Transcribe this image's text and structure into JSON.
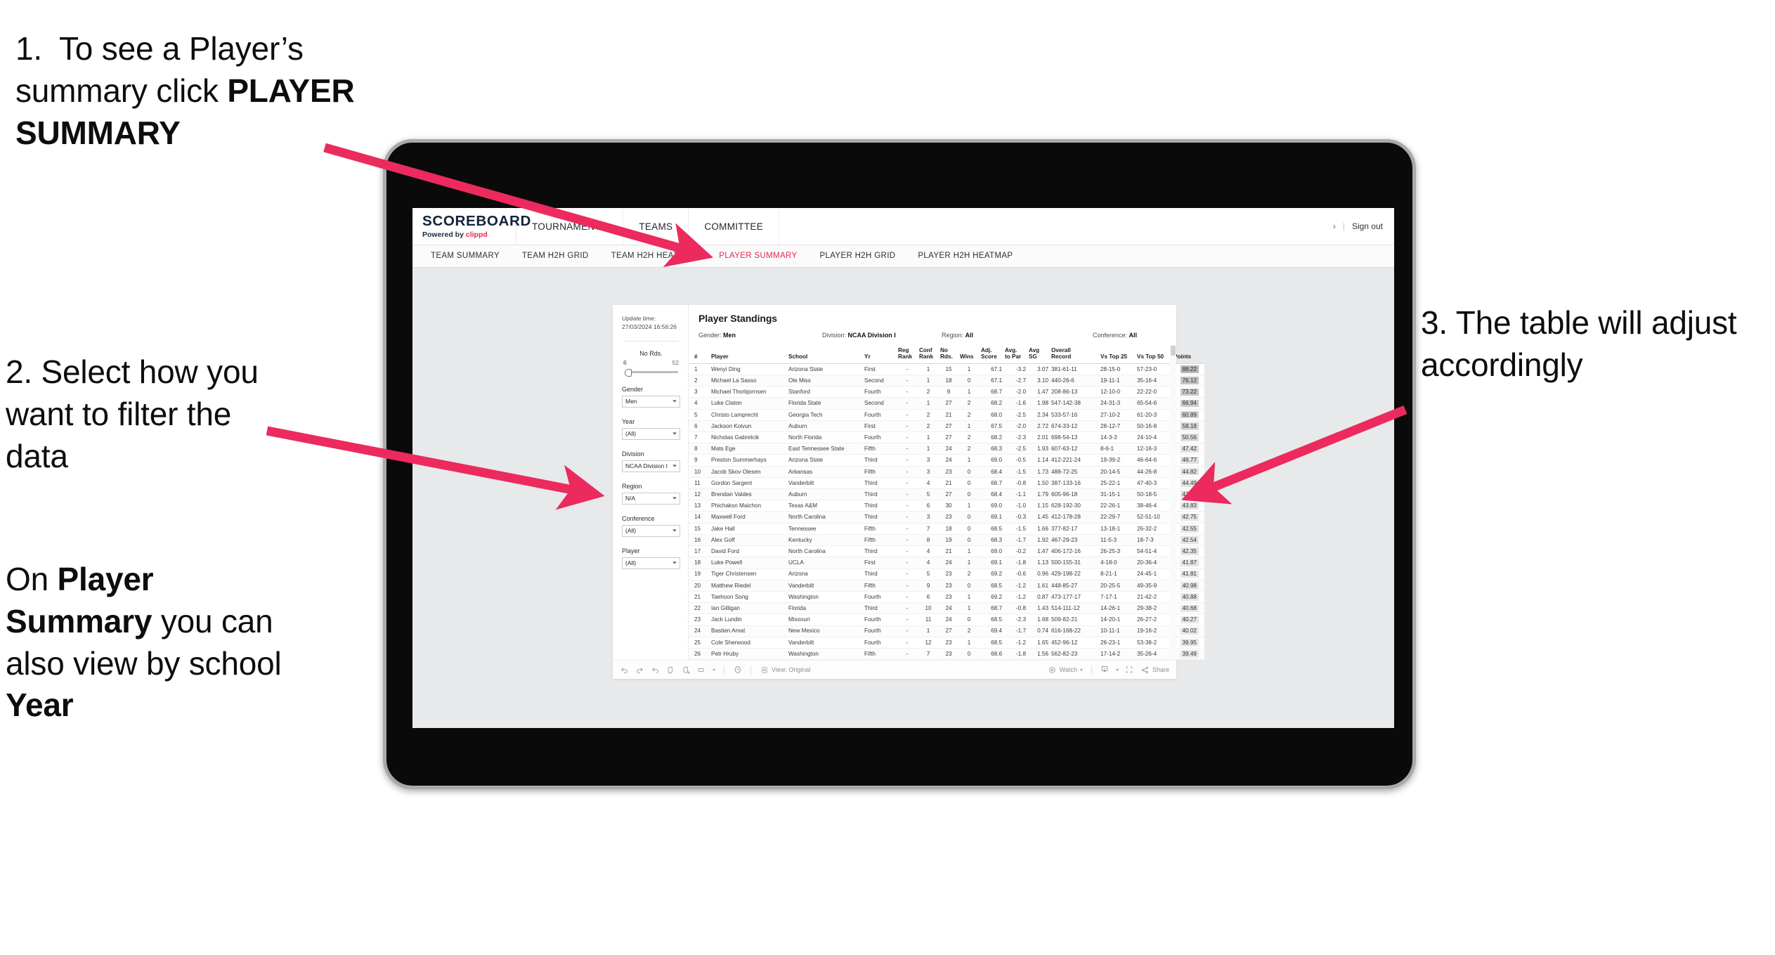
{
  "annotations": {
    "step1": {
      "number": "1.",
      "line1": "To see a Player’s",
      "line2_pre": "summary click ",
      "line2_bold": "PLAYER",
      "line3_bold": "SUMMARY"
    },
    "step2": {
      "text": "2. Select how you want to filter the data"
    },
    "step2b": {
      "pre": "On ",
      "bold1": "Player Summary",
      "mid": " you can also view by school ",
      "bold2": "Year"
    },
    "step3": {
      "text": "3. The table will adjust accordingly"
    }
  },
  "app": {
    "brand": {
      "title": "SCOREBOARD",
      "powered_prefix": "Powered by ",
      "powered_name": "clippd"
    },
    "main_nav": [
      {
        "label": "TOURNAMENTS"
      },
      {
        "label": "TEAMS"
      },
      {
        "label": "COMMITTEE"
      }
    ],
    "header_right": {
      "chevron": "›",
      "separator": "|",
      "sign_out": "Sign out"
    },
    "tabs": [
      {
        "label": "TEAM SUMMARY",
        "active": false
      },
      {
        "label": "TEAM H2H GRID",
        "active": false
      },
      {
        "label": "TEAM H2H HEATMAP",
        "active": false
      },
      {
        "label": "PLAYER SUMMARY",
        "active": true
      },
      {
        "label": "PLAYER H2H GRID",
        "active": false
      },
      {
        "label": "PLAYER H2H HEATMAP",
        "active": false
      }
    ],
    "accent_color": "#e8264f",
    "brand_navy": "#13233b"
  },
  "filters": {
    "update_time_label": "Update time:",
    "update_time_value": "27/03/2024 16:56:26",
    "slider": {
      "label": "No Rds.",
      "min": "6",
      "max": "52",
      "value": "6"
    },
    "selects": [
      {
        "label": "Gender",
        "value": "Men"
      },
      {
        "label": "Year",
        "value": "(All)"
      },
      {
        "label": "Division",
        "value": "NCAA Division I"
      },
      {
        "label": "Region",
        "value": "N/A"
      },
      {
        "label": "Conference",
        "value": "(All)"
      },
      {
        "label": "Player",
        "value": "(All)"
      }
    ]
  },
  "viz": {
    "title": "Player Standings",
    "applied_filters": [
      {
        "label": "Gender: ",
        "value": "Men"
      },
      {
        "label": "Division: ",
        "value": "NCAA Division I"
      },
      {
        "label": "Region: ",
        "value": "All"
      },
      {
        "label": "Conference: ",
        "value": "All"
      }
    ],
    "toolbar": {
      "view_label": "View: Original",
      "watch_label": "Watch",
      "share_label": "Share",
      "icons": [
        "undo-icon",
        "redo-icon",
        "revert-icon",
        "refresh-icon",
        "pause-icon",
        "device-layout-icon",
        "dropdown-caret-icon",
        "clock-history-icon",
        "view-original-icon",
        "watch-eye-icon",
        "download-icon",
        "fullscreen-icon",
        "share-icon"
      ]
    }
  },
  "table": {
    "columns": [
      {
        "key": "rank",
        "l1": "#",
        "l2": ""
      },
      {
        "key": "player",
        "l1": "Player",
        "l2": ""
      },
      {
        "key": "school",
        "l1": "School",
        "l2": ""
      },
      {
        "key": "yr",
        "l1": "Yr",
        "l2": ""
      },
      {
        "key": "reg_rank",
        "l1": "Reg",
        "l2": "Rank"
      },
      {
        "key": "conf_rank",
        "l1": "Conf",
        "l2": "Rank"
      },
      {
        "key": "no_rds",
        "l1": "No",
        "l2": "Rds."
      },
      {
        "key": "wins",
        "l1": "Wins",
        "l2": ""
      },
      {
        "key": "adj_score",
        "l1": "Adj.",
        "l2": "Score"
      },
      {
        "key": "avg_to_par",
        "l1": "Avg.",
        "l2": "to Par"
      },
      {
        "key": "avg_sg",
        "l1": "Avg",
        "l2": "SG"
      },
      {
        "key": "overall_record",
        "l1": "Overall",
        "l2": "Record"
      },
      {
        "key": "vs_top_25",
        "l1": "Vs Top 25",
        "l2": ""
      },
      {
        "key": "vs_top_50",
        "l1": "Vs Top 50",
        "l2": ""
      },
      {
        "key": "points",
        "l1": "Points",
        "l2": ""
      }
    ],
    "rows": [
      {
        "rank": "1",
        "player": "Wenyi Ding",
        "school": "Arizona State",
        "yr": "First",
        "reg_rank": "-",
        "conf_rank": "1",
        "no_rds": "15",
        "wins": "1",
        "adj_score": "67.1",
        "avg_to_par": "-3.2",
        "avg_sg": "3.07",
        "overall_record": "381-61-11",
        "vs_top_25": "28-15-0",
        "vs_top_50": "57-23-0",
        "points": "88.22"
      },
      {
        "rank": "2",
        "player": "Michael La Sasso",
        "school": "Ole Miss",
        "yr": "Second",
        "reg_rank": "-",
        "conf_rank": "1",
        "no_rds": "18",
        "wins": "0",
        "adj_score": "67.1",
        "avg_to_par": "-2.7",
        "avg_sg": "3.10",
        "overall_record": "440-26-6",
        "vs_top_25": "19-11-1",
        "vs_top_50": "35-16-4",
        "points": "76.12"
      },
      {
        "rank": "3",
        "player": "Michael Thorbjornsen",
        "school": "Stanford",
        "yr": "Fourth",
        "reg_rank": "-",
        "conf_rank": "2",
        "no_rds": "9",
        "wins": "1",
        "adj_score": "68.7",
        "avg_to_par": "-2.0",
        "avg_sg": "1.47",
        "overall_record": "208-86-13",
        "vs_top_25": "12-10-0",
        "vs_top_50": "22-22-0",
        "points": "73.22"
      },
      {
        "rank": "4",
        "player": "Luke Claton",
        "school": "Florida State",
        "yr": "Second",
        "reg_rank": "-",
        "conf_rank": "1",
        "no_rds": "27",
        "wins": "2",
        "adj_score": "68.2",
        "avg_to_par": "-1.6",
        "avg_sg": "1.98",
        "overall_record": "547-142-38",
        "vs_top_25": "24-31-3",
        "vs_top_50": "65-54-6",
        "points": "66.94"
      },
      {
        "rank": "5",
        "player": "Christo Lamprecht",
        "school": "Georgia Tech",
        "yr": "Fourth",
        "reg_rank": "-",
        "conf_rank": "2",
        "no_rds": "21",
        "wins": "2",
        "adj_score": "68.0",
        "avg_to_par": "-2.5",
        "avg_sg": "2.34",
        "overall_record": "533-57-16",
        "vs_top_25": "27-10-2",
        "vs_top_50": "61-20-3",
        "points": "60.89"
      },
      {
        "rank": "6",
        "player": "Jackson Koivun",
        "school": "Auburn",
        "yr": "First",
        "reg_rank": "-",
        "conf_rank": "2",
        "no_rds": "27",
        "wins": "1",
        "adj_score": "67.5",
        "avg_to_par": "-2.0",
        "avg_sg": "2.72",
        "overall_record": "674-33-12",
        "vs_top_25": "28-12-7",
        "vs_top_50": "50-16-8",
        "points": "58.18"
      },
      {
        "rank": "7",
        "player": "Nicholas Gabrelcik",
        "school": "North Florida",
        "yr": "Fourth",
        "reg_rank": "-",
        "conf_rank": "1",
        "no_rds": "27",
        "wins": "2",
        "adj_score": "68.2",
        "avg_to_par": "-2.3",
        "avg_sg": "2.01",
        "overall_record": "698-54-13",
        "vs_top_25": "14-3-3",
        "vs_top_50": "24-10-4",
        "points": "50.56"
      },
      {
        "rank": "8",
        "player": "Mats Ege",
        "school": "East Tennessee State",
        "yr": "Fifth",
        "reg_rank": "-",
        "conf_rank": "1",
        "no_rds": "24",
        "wins": "2",
        "adj_score": "68.3",
        "avg_to_par": "-2.5",
        "avg_sg": "1.93",
        "overall_record": "607-63-12",
        "vs_top_25": "8-6-1",
        "vs_top_50": "12-16-3",
        "points": "47.42"
      },
      {
        "rank": "9",
        "player": "Preston Summerhays",
        "school": "Arizona State",
        "yr": "Third",
        "reg_rank": "-",
        "conf_rank": "3",
        "no_rds": "24",
        "wins": "1",
        "adj_score": "69.0",
        "avg_to_par": "-0.5",
        "avg_sg": "1.14",
        "overall_record": "412-221-24",
        "vs_top_25": "19-39-2",
        "vs_top_50": "46-64-6",
        "points": "46.77"
      },
      {
        "rank": "10",
        "player": "Jacob Skov Olesen",
        "school": "Arkansas",
        "yr": "Fifth",
        "reg_rank": "-",
        "conf_rank": "3",
        "no_rds": "23",
        "wins": "0",
        "adj_score": "68.4",
        "avg_to_par": "-1.5",
        "avg_sg": "1.73",
        "overall_record": "488-72-25",
        "vs_top_25": "20-14-5",
        "vs_top_50": "44-26-8",
        "points": "44.82"
      },
      {
        "rank": "11",
        "player": "Gordon Sargent",
        "school": "Vanderbilt",
        "yr": "Third",
        "reg_rank": "-",
        "conf_rank": "4",
        "no_rds": "21",
        "wins": "0",
        "adj_score": "68.7",
        "avg_to_par": "-0.8",
        "avg_sg": "1.50",
        "overall_record": "387-133-16",
        "vs_top_25": "25-22-1",
        "vs_top_50": "47-40-3",
        "points": "44.49"
      },
      {
        "rank": "12",
        "player": "Brendan Valdes",
        "school": "Auburn",
        "yr": "Third",
        "reg_rank": "-",
        "conf_rank": "5",
        "no_rds": "27",
        "wins": "0",
        "adj_score": "68.4",
        "avg_to_par": "-1.1",
        "avg_sg": "1.79",
        "overall_record": "605-96-18",
        "vs_top_25": "31-15-1",
        "vs_top_50": "50-18-5",
        "points": "43.95"
      },
      {
        "rank": "13",
        "player": "Phichaksn Maichon",
        "school": "Texas A&M",
        "yr": "Third",
        "reg_rank": "-",
        "conf_rank": "6",
        "no_rds": "30",
        "wins": "1",
        "adj_score": "69.0",
        "avg_to_par": "-1.0",
        "avg_sg": "1.15",
        "overall_record": "628-192-30",
        "vs_top_25": "22-26-1",
        "vs_top_50": "38-46-4",
        "points": "43.83"
      },
      {
        "rank": "14",
        "player": "Maxwell Ford",
        "school": "North Carolina",
        "yr": "Third",
        "reg_rank": "-",
        "conf_rank": "3",
        "no_rds": "23",
        "wins": "0",
        "adj_score": "69.1",
        "avg_to_par": "-0.3",
        "avg_sg": "1.45",
        "overall_record": "412-178-28",
        "vs_top_25": "22-29-7",
        "vs_top_50": "52-51-10",
        "points": "42.75"
      },
      {
        "rank": "15",
        "player": "Jake Hall",
        "school": "Tennessee",
        "yr": "Fifth",
        "reg_rank": "-",
        "conf_rank": "7",
        "no_rds": "18",
        "wins": "0",
        "adj_score": "68.5",
        "avg_to_par": "-1.5",
        "avg_sg": "1.66",
        "overall_record": "377-82-17",
        "vs_top_25": "13-18-1",
        "vs_top_50": "26-32-2",
        "points": "42.55"
      },
      {
        "rank": "16",
        "player": "Alex Goff",
        "school": "Kentucky",
        "yr": "Fifth",
        "reg_rank": "-",
        "conf_rank": "8",
        "no_rds": "19",
        "wins": "0",
        "adj_score": "68.3",
        "avg_to_par": "-1.7",
        "avg_sg": "1.92",
        "overall_record": "467-29-23",
        "vs_top_25": "11-5-3",
        "vs_top_50": "18-7-3",
        "points": "42.54"
      },
      {
        "rank": "17",
        "player": "David Ford",
        "school": "North Carolina",
        "yr": "Third",
        "reg_rank": "-",
        "conf_rank": "4",
        "no_rds": "21",
        "wins": "1",
        "adj_score": "69.0",
        "avg_to_par": "-0.2",
        "avg_sg": "1.47",
        "overall_record": "406-172-16",
        "vs_top_25": "26-25-3",
        "vs_top_50": "54-51-4",
        "points": "42.35"
      },
      {
        "rank": "18",
        "player": "Luke Powell",
        "school": "UCLA",
        "yr": "First",
        "reg_rank": "-",
        "conf_rank": "4",
        "no_rds": "24",
        "wins": "1",
        "adj_score": "69.1",
        "avg_to_par": "-1.8",
        "avg_sg": "1.13",
        "overall_record": "500-155-31",
        "vs_top_25": "4-18-0",
        "vs_top_50": "20-36-4",
        "points": "41.87"
      },
      {
        "rank": "19",
        "player": "Tiger Christensen",
        "school": "Arizona",
        "yr": "Third",
        "reg_rank": "-",
        "conf_rank": "5",
        "no_rds": "23",
        "wins": "2",
        "adj_score": "69.2",
        "avg_to_par": "-0.6",
        "avg_sg": "0.96",
        "overall_record": "429-198-22",
        "vs_top_25": "8-21-1",
        "vs_top_50": "24-45-1",
        "points": "41.81"
      },
      {
        "rank": "20",
        "player": "Matthew Riedel",
        "school": "Vanderbilt",
        "yr": "Fifth",
        "reg_rank": "-",
        "conf_rank": "9",
        "no_rds": "23",
        "wins": "0",
        "adj_score": "68.5",
        "avg_to_par": "-1.2",
        "avg_sg": "1.61",
        "overall_record": "448-85-27",
        "vs_top_25": "20-25-5",
        "vs_top_50": "49-35-9",
        "points": "40.98"
      },
      {
        "rank": "21",
        "player": "Taehoon Song",
        "school": "Washington",
        "yr": "Fourth",
        "reg_rank": "-",
        "conf_rank": "6",
        "no_rds": "23",
        "wins": "1",
        "adj_score": "69.2",
        "avg_to_par": "-1.2",
        "avg_sg": "0.87",
        "overall_record": "473-177-17",
        "vs_top_25": "7-17-1",
        "vs_top_50": "21-42-2",
        "points": "40.88"
      },
      {
        "rank": "22",
        "player": "Ian Gilligan",
        "school": "Florida",
        "yr": "Third",
        "reg_rank": "-",
        "conf_rank": "10",
        "no_rds": "24",
        "wins": "1",
        "adj_score": "68.7",
        "avg_to_par": "-0.8",
        "avg_sg": "1.43",
        "overall_record": "514-111-12",
        "vs_top_25": "14-26-1",
        "vs_top_50": "29-38-2",
        "points": "40.68"
      },
      {
        "rank": "23",
        "player": "Jack Lundin",
        "school": "Missouri",
        "yr": "Fourth",
        "reg_rank": "-",
        "conf_rank": "11",
        "no_rds": "24",
        "wins": "0",
        "adj_score": "68.5",
        "avg_to_par": "-2.3",
        "avg_sg": "1.68",
        "overall_record": "509-82-21",
        "vs_top_25": "14-20-1",
        "vs_top_50": "26-27-2",
        "points": "40.27"
      },
      {
        "rank": "24",
        "player": "Bastien Amat",
        "school": "New Mexico",
        "yr": "Fourth",
        "reg_rank": "-",
        "conf_rank": "1",
        "no_rds": "27",
        "wins": "2",
        "adj_score": "69.4",
        "avg_to_par": "-1.7",
        "avg_sg": "0.74",
        "overall_record": "616-168-22",
        "vs_top_25": "10-11-1",
        "vs_top_50": "19-16-2",
        "points": "40.02"
      },
      {
        "rank": "25",
        "player": "Cole Sherwood",
        "school": "Vanderbilt",
        "yr": "Fourth",
        "reg_rank": "-",
        "conf_rank": "12",
        "no_rds": "23",
        "wins": "1",
        "adj_score": "68.5",
        "avg_to_par": "-1.2",
        "avg_sg": "1.65",
        "overall_record": "452-96-12",
        "vs_top_25": "26-23-1",
        "vs_top_50": "53-38-2",
        "points": "39.95"
      },
      {
        "rank": "26",
        "player": "Petr Hruby",
        "school": "Washington",
        "yr": "Fifth",
        "reg_rank": "-",
        "conf_rank": "7",
        "no_rds": "23",
        "wins": "0",
        "adj_score": "68.6",
        "avg_to_par": "-1.8",
        "avg_sg": "1.56",
        "overall_record": "562-82-23",
        "vs_top_25": "17-14-2",
        "vs_top_50": "35-26-4",
        "points": "39.49"
      }
    ]
  }
}
